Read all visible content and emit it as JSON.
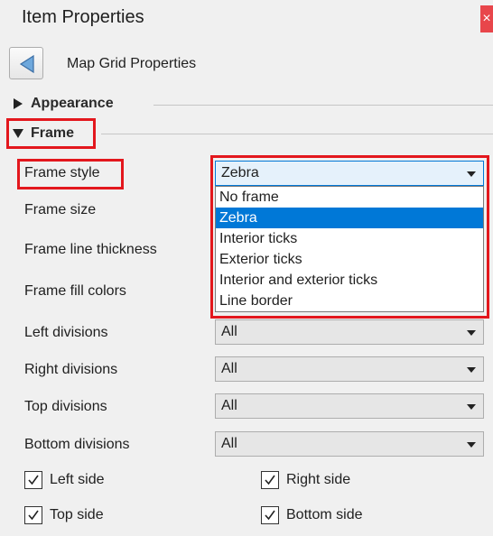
{
  "window": {
    "title": "Item Properties",
    "close_glyph": "×"
  },
  "nav": {
    "title": "Map Grid Properties",
    "back_icon": "triangle-left-icon"
  },
  "sections": {
    "appearance": {
      "label": "Appearance",
      "expanded": false
    },
    "frame": {
      "label": "Frame",
      "expanded": true
    }
  },
  "frame_style": {
    "label": "Frame style",
    "value": "Zebra",
    "options": [
      "No frame",
      "Zebra",
      "Interior ticks",
      "Exterior ticks",
      "Interior and exterior ticks",
      "Line border"
    ],
    "selected_index": 1
  },
  "rows": {
    "frame_size": {
      "label": "Frame size"
    },
    "frame_line_thickness": {
      "label": "Frame line thickness"
    },
    "frame_fill_colors": {
      "label": "Frame fill colors"
    },
    "left_divisions": {
      "label": "Left divisions",
      "value": "All"
    },
    "right_divisions": {
      "label": "Right divisions",
      "value": "All"
    },
    "top_divisions": {
      "label": "Top divisions",
      "value": "All"
    },
    "bottom_divisions": {
      "label": "Bottom divisions",
      "value": "All"
    }
  },
  "checkboxes": {
    "left_side": {
      "label": "Left side",
      "checked": true
    },
    "right_side": {
      "label": "Right side",
      "checked": true
    },
    "top_side": {
      "label": "Top side",
      "checked": true
    },
    "bottom_side": {
      "label": "Bottom side",
      "checked": true
    }
  },
  "colors": {
    "highlight": "#e3171d",
    "selection": "#0078d7",
    "close": "#e8464b"
  }
}
